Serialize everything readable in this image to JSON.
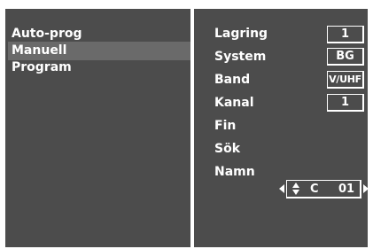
{
  "left_menu": {
    "items": [
      {
        "label": "Auto-prog",
        "selected": false
      },
      {
        "label": "Manuell",
        "selected": true
      },
      {
        "label": "Program",
        "selected": false
      }
    ]
  },
  "right_panel": {
    "fields": [
      {
        "label": "Lagring",
        "value": "1"
      },
      {
        "label": "System",
        "value": "BG"
      },
      {
        "label": "Band",
        "value": "V/UHF"
      },
      {
        "label": "Kanal",
        "value": "1"
      },
      {
        "label": "Fin",
        "value": ""
      },
      {
        "label": "Sök",
        "value": ""
      },
      {
        "label": "Namn",
        "value": ""
      }
    ],
    "name_editor": {
      "letter": "C",
      "number": "01"
    }
  },
  "colors": {
    "panel_bg": "#4c4c4c",
    "selected_bg": "#6a6a6a",
    "text": "#ffffff",
    "frame": "#ffffff"
  },
  "icons": {
    "left_arrow": "triangle-left-icon",
    "right_arrow": "triangle-right-icon",
    "up_down": "up-down-arrows-icon"
  }
}
